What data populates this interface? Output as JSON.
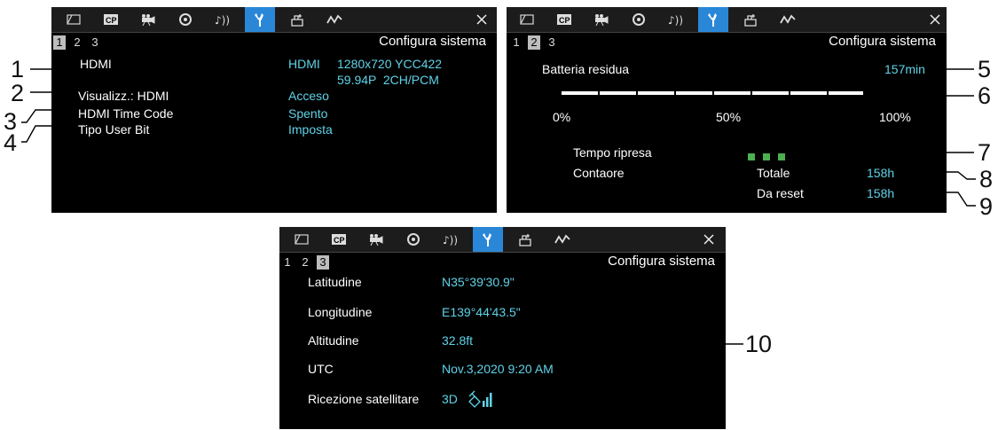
{
  "panel1": {
    "title": "Configura sistema",
    "pages": [
      "1",
      "2",
      "3"
    ],
    "hdmi_label": "HDMI",
    "hdmi_value_prefix": "HDMI",
    "hdmi_value_line1": "1280x720 YCC422",
    "hdmi_value_line2": "59.94P  2CH/PCM",
    "rows": [
      {
        "label": "Visualizz.: HDMI",
        "value": "Acceso"
      },
      {
        "label": "HDMI Time Code",
        "value": "Spento"
      },
      {
        "label": "Tipo User Bit",
        "value": "Imposta"
      }
    ]
  },
  "panel2": {
    "title": "Configura sistema",
    "pages": [
      "1",
      "2",
      "3"
    ],
    "battery_label": "Batteria residua",
    "battery_value": "157min",
    "battery_level_fraction": 1.0,
    "scale": [
      "0%",
      "50%",
      "100%"
    ],
    "rec_time_label": "Tempo ripresa",
    "hour_counter_label": "Contaore",
    "total_label": "Totale",
    "total_value": "158h",
    "reset_label": "Da reset",
    "reset_value": "158h"
  },
  "panel3": {
    "title": "Configura sistema",
    "pages": [
      "1",
      "2",
      "3"
    ],
    "rows": [
      {
        "label": "Latitudine",
        "value": "N35°39'30.9\""
      },
      {
        "label": "Longitudine",
        "value": "E139°44'43.5\""
      },
      {
        "label": "Altitudine",
        "value": "32.8ft"
      },
      {
        "label": "UTC",
        "value": "Nov.3,2020 9:20 AM"
      },
      {
        "label": "Ricezione satellitare",
        "value": "3D"
      }
    ],
    "satellite_icon": "satellite-signal-icon"
  },
  "callouts": [
    "1",
    "2",
    "3",
    "4",
    "5",
    "6",
    "7",
    "8",
    "9",
    "10"
  ],
  "colors": {
    "value_cyan": "#5fd3e8",
    "active_tab": "#2a87d8",
    "rec_indicator": "#4caf50"
  }
}
